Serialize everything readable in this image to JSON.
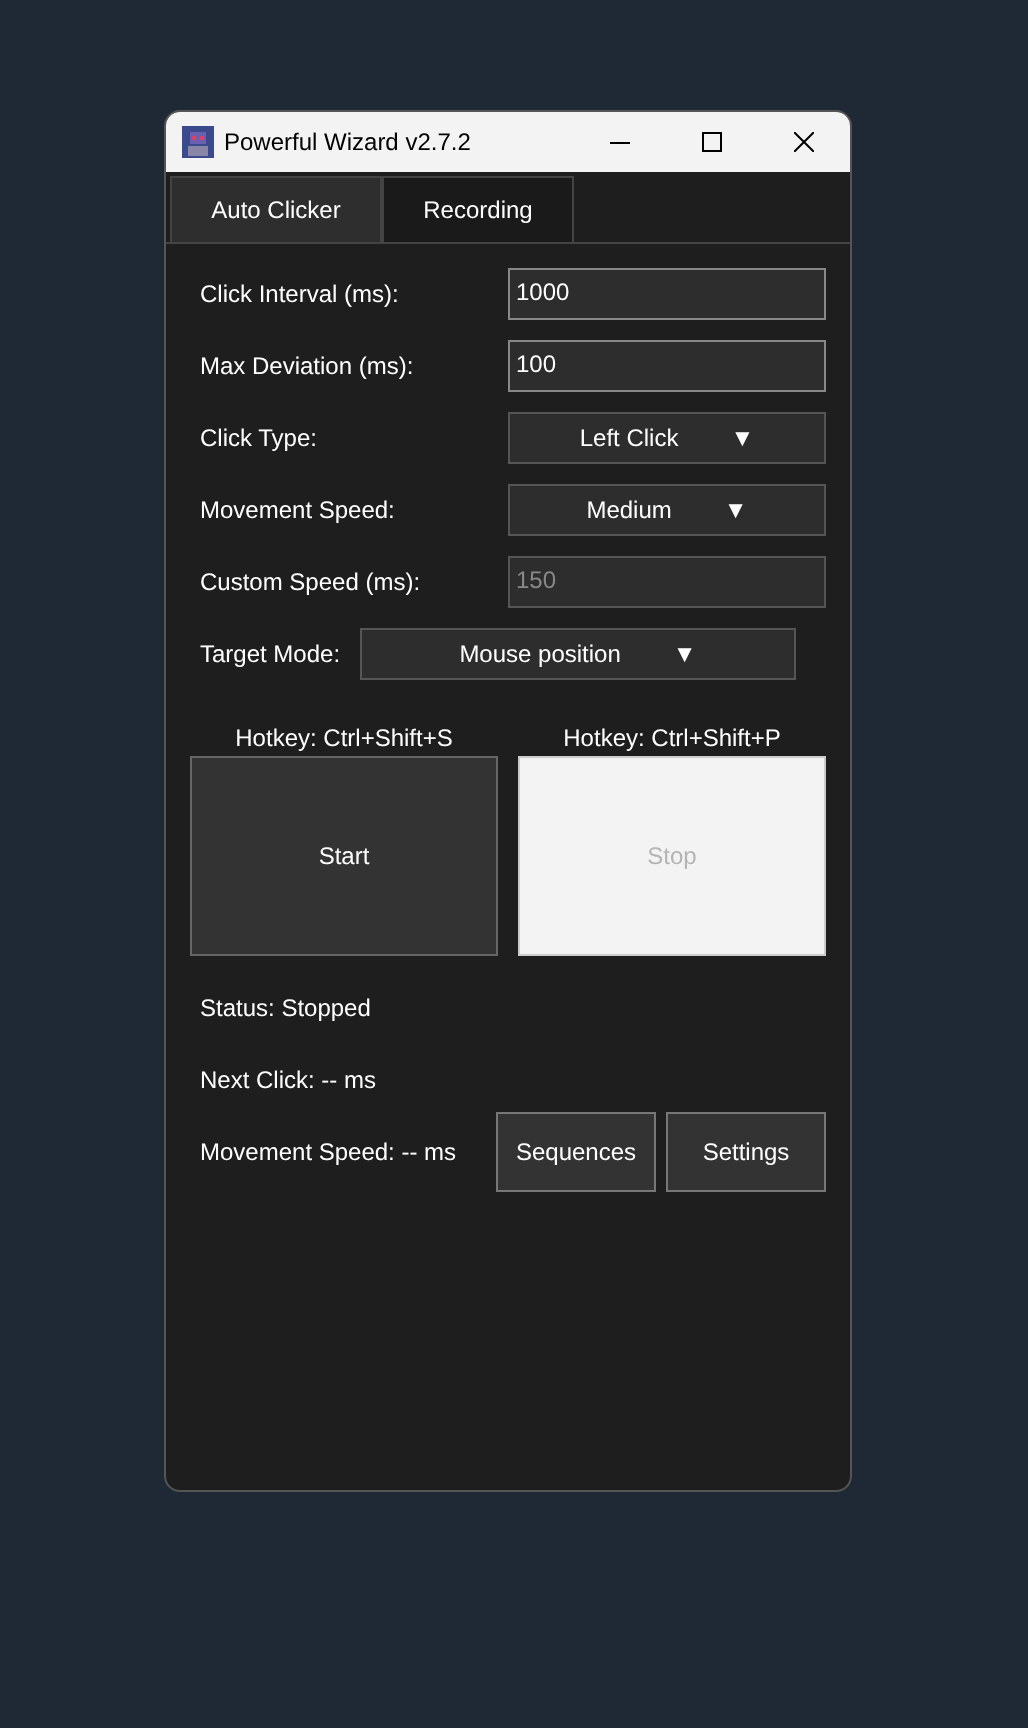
{
  "window": {
    "title": "Powerful Wizard v2.7.2"
  },
  "tabs": [
    {
      "label": "Auto Clicker",
      "selected": true
    },
    {
      "label": "Recording",
      "selected": false
    }
  ],
  "settings": [
    {
      "label": "Click Interval (ms):",
      "kind": "text",
      "value": "1000",
      "disabled": false
    },
    {
      "label": "Max Deviation (ms):",
      "kind": "text",
      "value": "100",
      "disabled": false
    },
    {
      "label": "Click Type:",
      "kind": "dropdown",
      "value": "Left Click",
      "disabled": false
    },
    {
      "label": "Movement Speed:",
      "kind": "dropdown",
      "value": "Medium",
      "disabled": false
    },
    {
      "label": "Custom Speed (ms):",
      "kind": "text",
      "value": "150",
      "disabled": true
    }
  ],
  "target_mode": {
    "label": "Target Mode:",
    "value": "Mouse position",
    "arrow": "▼"
  },
  "dropdown_arrow": "▼",
  "controls": [
    {
      "hotkey": "Hotkey: Ctrl+Shift+S",
      "label": "Start",
      "disabled": false
    },
    {
      "hotkey": "Hotkey: Ctrl+Shift+P",
      "label": "Stop",
      "disabled": true
    }
  ],
  "status": [
    "Status: Stopped",
    "Next Click: -- ms",
    "Movement Speed: -- ms"
  ],
  "buttons": [
    "Sequences",
    "Settings"
  ]
}
